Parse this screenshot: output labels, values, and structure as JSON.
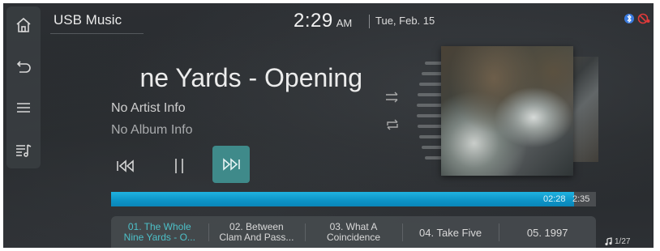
{
  "header": {
    "source": "USB Music",
    "time": "2:29",
    "ampm": "AM",
    "date": "Tue, Feb. 15"
  },
  "rail": {
    "icons": [
      "home-icon",
      "back-icon",
      "menu-icon",
      "playlist-icon"
    ]
  },
  "track": {
    "title": "ne Yards - Opening",
    "artist": "No Artist Info",
    "album": "No Album Info"
  },
  "progress": {
    "current": "02:28",
    "total": "2:35",
    "fraction": 0.955
  },
  "playlist": {
    "items": [
      "01. The Whole\nNine Yards - O...",
      "02. Between\nClam And Pass...",
      "03. What A\nCoincidence",
      "04. Take Five",
      "05. 1997"
    ],
    "active_index": 0,
    "count": "1/27"
  },
  "colors": {
    "accent": "#3f8a8a",
    "progress": "#1fb2e0",
    "active_text": "#4dc0c8",
    "status_red": "#e03a3a",
    "status_blue": "#3a7be0"
  }
}
